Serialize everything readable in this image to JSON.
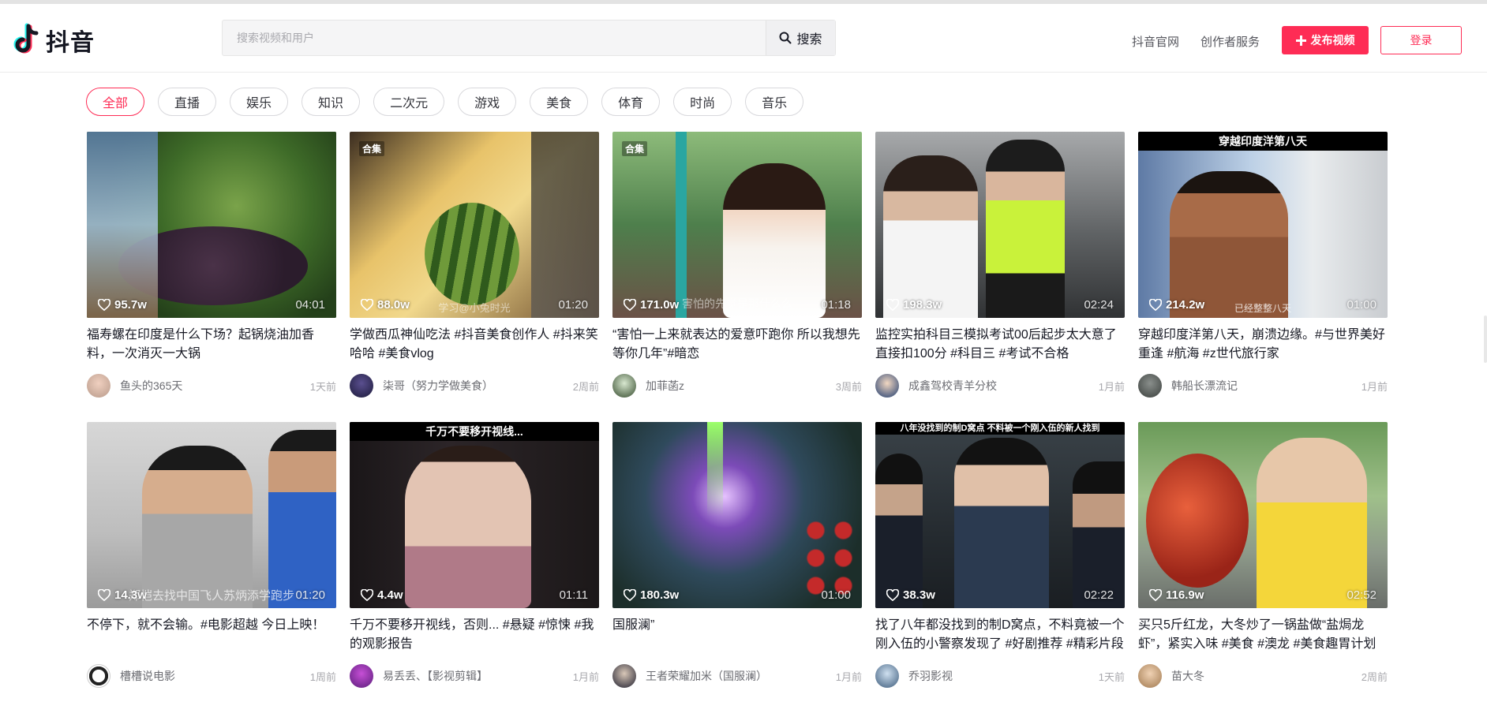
{
  "app": {
    "name": "抖音",
    "brand_color": "#fe2c55"
  },
  "search": {
    "placeholder": "搜索视频和用户",
    "button_label": "搜索"
  },
  "nav": {
    "official": "抖音官网",
    "creator": "创作者服务",
    "publish": "发布视频",
    "login": "登录"
  },
  "categories": [
    {
      "label": "全部",
      "active": true
    },
    {
      "label": "直播"
    },
    {
      "label": "娱乐"
    },
    {
      "label": "知识"
    },
    {
      "label": "二次元"
    },
    {
      "label": "游戏"
    },
    {
      "label": "美食"
    },
    {
      "label": "体育"
    },
    {
      "label": "时尚"
    },
    {
      "label": "音乐"
    }
  ],
  "videos": [
    {
      "likes": "95.7w",
      "duration": "04:01",
      "title": "福寿螺在印度是什么下场？起锅烧油加香料，一次消灭一大锅",
      "author": "鱼头的365天",
      "time": "1天前"
    },
    {
      "likes": "88.0w",
      "duration": "01:20",
      "title": "学做西瓜神仙吃法 #抖音美食创作人 #抖来笑哈哈 #美食vlog",
      "author": "柒哥（努力学做美食）",
      "time": "2周前",
      "badge": "合集",
      "overlay": "学习@小兔时光"
    },
    {
      "likes": "171.0w",
      "duration": "01:18",
      "title": "“害怕一上来就表达的爱意吓跑你 所以我想先等你几年”#暗恋",
      "author": "加菲菡z",
      "time": "3周前",
      "badge": "合集",
      "overlay": "害怕的先觉是那什么么"
    },
    {
      "likes": "198.3w",
      "duration": "02:24",
      "title": "监控实拍科目三模拟考试00后起步太大意了直接扣100分 #科目三 #考试不合格",
      "author": "成鑫驾校青羊分校",
      "time": "1月前"
    },
    {
      "likes": "214.2w",
      "duration": "01:00",
      "title": "穿越印度洋第八天，崩溃边缘。#与世界美好重逢 #航海 #z世代旅行家",
      "author": "韩船长漂流记",
      "time": "1月前",
      "banner": "穿越印度洋第八天",
      "overlay": "已经整整八天"
    },
    {
      "likes": "14.3w",
      "duration": "01:20",
      "title": "不停下，就不会输。#电影超越 今日上映！",
      "author": "槽槽说电影",
      "time": "1周前",
      "overlay": "郑恺去找中国飞人苏炳添学跑步"
    },
    {
      "likes": "4.4w",
      "duration": "01:11",
      "title": "千万不要移开视线，否则... #悬疑 #惊悚 #我的观影报告",
      "author": "易丢丢、【影视剪辑】",
      "time": "1月前",
      "banner": "千万不要移开视线..."
    },
    {
      "likes": "180.3w",
      "duration": "01:00",
      "title": "国服澜”",
      "author": "王者荣耀加米（国服澜）",
      "time": "1月前"
    },
    {
      "likes": "38.3w",
      "duration": "02:22",
      "title": "找了八年都没找到的制D窝点，不料竟被一个刚入伍的小警察发现了 #好剧推荐 #精彩片段",
      "author": "乔羽影视",
      "time": "1天前",
      "banner": "八年没找到的制D窝点  不料被一个刚入伍的新人找到"
    },
    {
      "likes": "116.9w",
      "duration": "02:52",
      "title": "买只5斤红龙，大冬炒了一锅盐做“盐焗龙虾”，紧实入味 #美食 #澳龙 #美食趣胃计划",
      "author": "苗大冬",
      "time": "2周前"
    }
  ]
}
